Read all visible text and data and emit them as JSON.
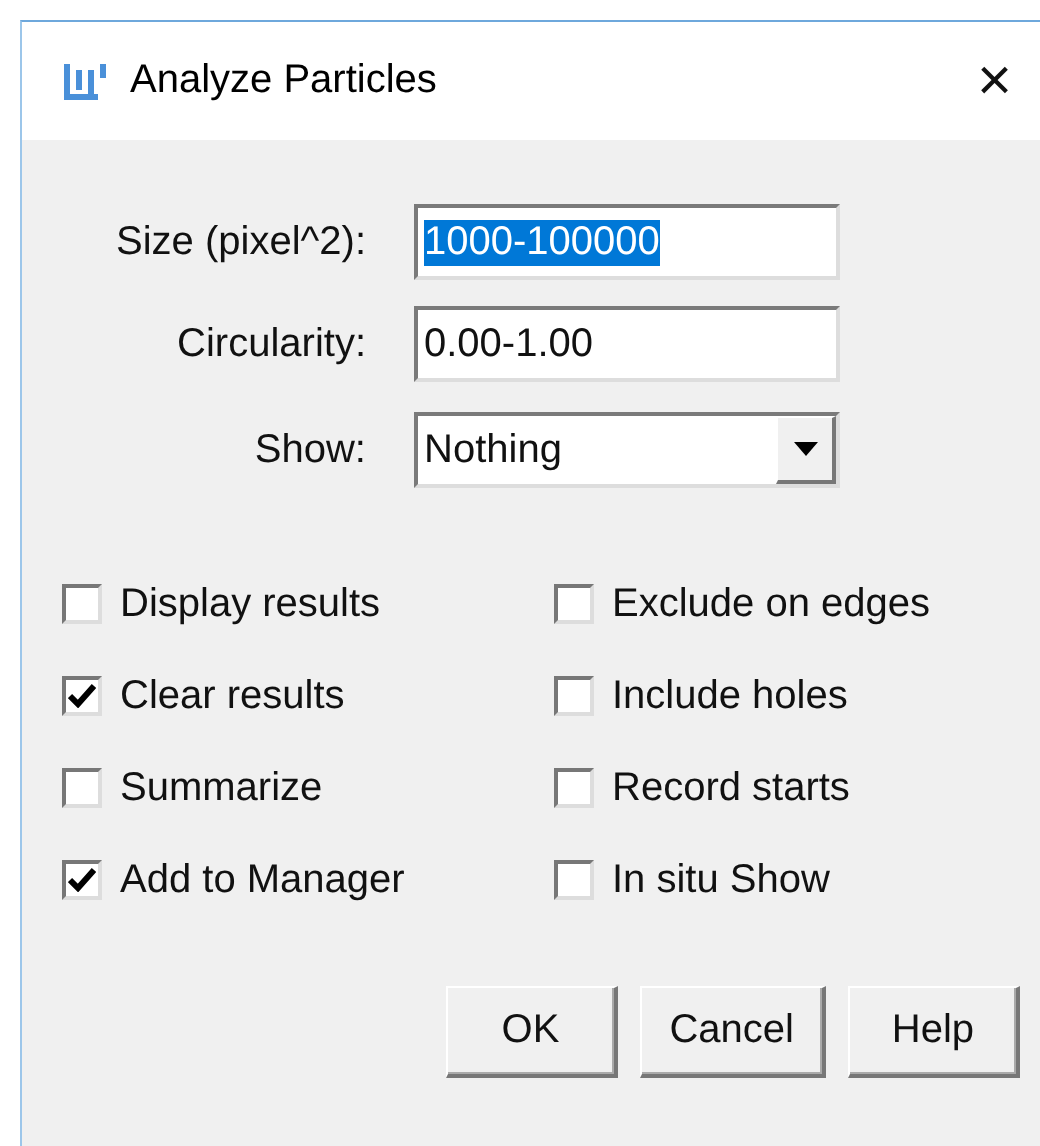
{
  "window": {
    "title": "Analyze Particles",
    "close": "×"
  },
  "fields": [
    {
      "label": "Size (pixel^2):",
      "value": "1000-100000",
      "selected": true
    },
    {
      "label": "Circularity:",
      "value": "0.00-1.00",
      "selected": false
    }
  ],
  "show": {
    "label": "Show:",
    "value": "Nothing"
  },
  "checkboxes": [
    {
      "label": "Display results",
      "checked": false
    },
    {
      "label": "Exclude on edges",
      "checked": false
    },
    {
      "label": "Clear results",
      "checked": true
    },
    {
      "label": "Include holes",
      "checked": false
    },
    {
      "label": "Summarize",
      "checked": false
    },
    {
      "label": "Record starts",
      "checked": false
    },
    {
      "label": "Add to Manager",
      "checked": true
    },
    {
      "label": "In situ Show",
      "checked": false
    }
  ],
  "buttons": [
    "OK",
    "Cancel",
    "Help"
  ]
}
